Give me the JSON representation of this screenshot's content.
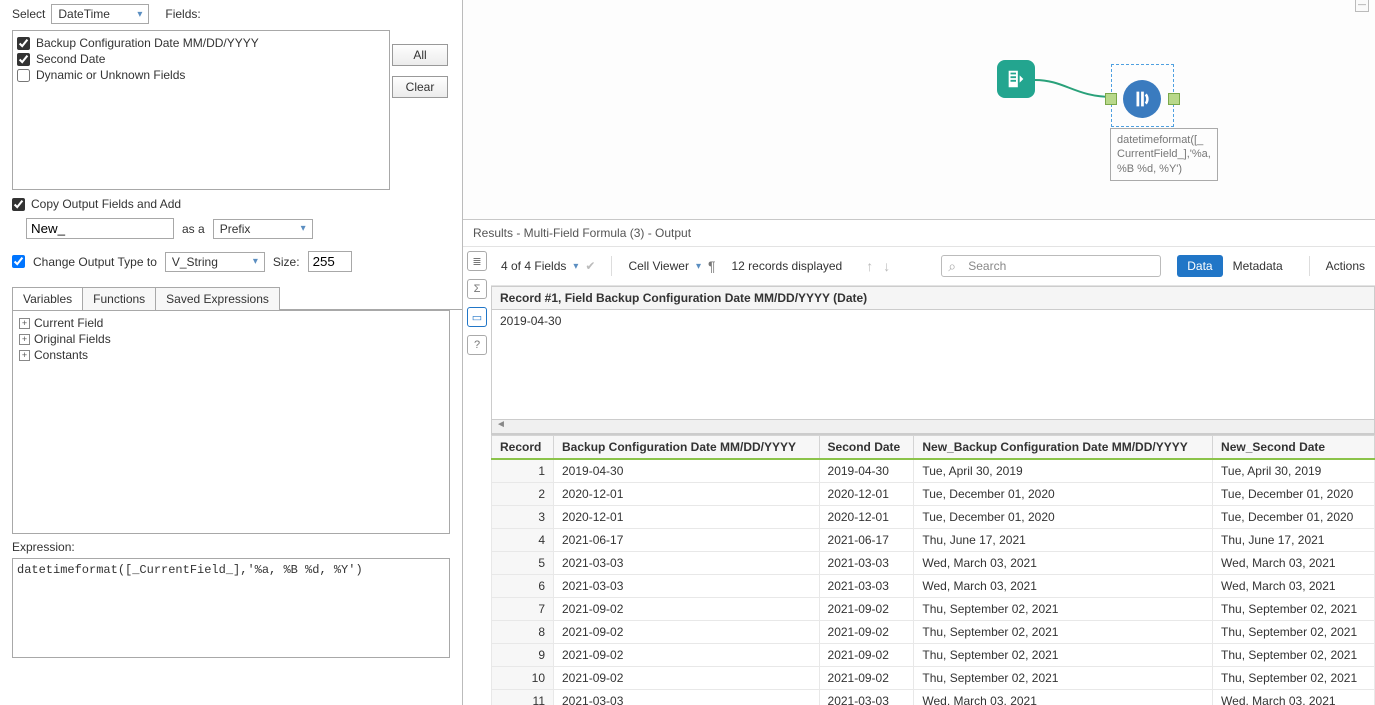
{
  "config": {
    "select_label": "Select",
    "select_value": "DateTime",
    "fields_label": "Fields:",
    "all_btn": "All",
    "clear_btn": "Clear",
    "field_options": [
      {
        "label": "Backup Configuration Date MM/DD/YYYY",
        "checked": true
      },
      {
        "label": "Second Date",
        "checked": true
      },
      {
        "label": "Dynamic or Unknown Fields",
        "checked": false
      }
    ],
    "copy_output_label": "Copy Output Fields and Add",
    "prefix_value": "New_",
    "asa_label": "as a",
    "prefix_combo": "Prefix",
    "change_output_label": "Change Output Type to",
    "output_type": "V_String",
    "size_label": "Size:",
    "size_value": "255",
    "tabs": [
      "Variables",
      "Functions",
      "Saved Expressions"
    ],
    "tree": [
      "Current Field",
      "Original Fields",
      "Constants"
    ],
    "expression_label": "Expression:",
    "expression_text": "datetimeformat([_CurrentField_],'%a, %B %d, %Y')"
  },
  "canvas": {
    "tool_caption": "datetimeformat([_CurrentField_],'%a, %B %d, %Y')"
  },
  "results": {
    "title": "Results - Multi-Field Formula (3) - Output",
    "fields_info": "4 of 4 Fields",
    "cell_viewer": "Cell Viewer",
    "records_info": "12 records displayed",
    "search_placeholder": "Search",
    "view_data": "Data",
    "view_meta": "Metadata",
    "actions": "Actions",
    "record_header": "Record #1, Field Backup Configuration Date MM/DD/YYYY (Date)",
    "record_value": "2019-04-30",
    "columns": [
      "Record",
      "Backup Configuration Date MM/DD/YYYY",
      "Second Date",
      "New_Backup Configuration Date MM/DD/YYYY",
      "New_Second Date"
    ],
    "rows": [
      [
        "1",
        "2019-04-30",
        "2019-04-30",
        "Tue, April 30, 2019",
        "Tue, April 30, 2019"
      ],
      [
        "2",
        "2020-12-01",
        "2020-12-01",
        "Tue, December 01, 2020",
        "Tue, December 01, 2020"
      ],
      [
        "3",
        "2020-12-01",
        "2020-12-01",
        "Tue, December 01, 2020",
        "Tue, December 01, 2020"
      ],
      [
        "4",
        "2021-06-17",
        "2021-06-17",
        "Thu, June 17, 2021",
        "Thu, June 17, 2021"
      ],
      [
        "5",
        "2021-03-03",
        "2021-03-03",
        "Wed, March 03, 2021",
        "Wed, March 03, 2021"
      ],
      [
        "6",
        "2021-03-03",
        "2021-03-03",
        "Wed, March 03, 2021",
        "Wed, March 03, 2021"
      ],
      [
        "7",
        "2021-09-02",
        "2021-09-02",
        "Thu, September 02, 2021",
        "Thu, September 02, 2021"
      ],
      [
        "8",
        "2021-09-02",
        "2021-09-02",
        "Thu, September 02, 2021",
        "Thu, September 02, 2021"
      ],
      [
        "9",
        "2021-09-02",
        "2021-09-02",
        "Thu, September 02, 2021",
        "Thu, September 02, 2021"
      ],
      [
        "10",
        "2021-09-02",
        "2021-09-02",
        "Thu, September 02, 2021",
        "Thu, September 02, 2021"
      ],
      [
        "11",
        "2021-03-03",
        "2021-03-03",
        "Wed, March 03, 2021",
        "Wed, March 03, 2021"
      ]
    ]
  }
}
